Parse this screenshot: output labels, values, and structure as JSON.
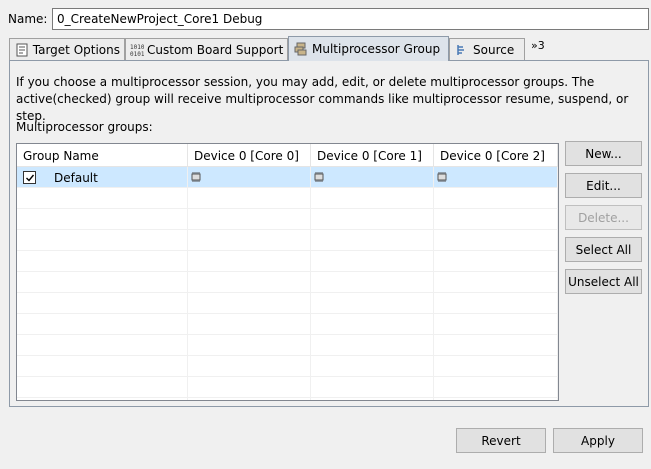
{
  "name": {
    "label": "Name:",
    "value": "0_CreateNewProject_Core1 Debug"
  },
  "tabs": [
    {
      "label": "Target Options",
      "icon": "target-options-icon"
    },
    {
      "label": "Custom Board Support",
      "icon": "board-support-icon"
    },
    {
      "label": "Multiprocessor Group",
      "icon": "multiprocessor-icon",
      "active": true
    },
    {
      "label": "Source",
      "icon": "source-icon"
    }
  ],
  "tabs_overflow": "»3",
  "description": "If you choose a multiprocessor session, you may add, edit, or delete multiprocessor groups.  The active(checked) group will receive multiprocessor commands like multiprocessor resume, suspend, or step.",
  "groups_label": "Multiprocessor groups:",
  "table": {
    "columns": [
      "Group Name",
      "Device 0 [Core 0]",
      "Device 0 [Core 1]",
      "Device 0 [Core 2]"
    ],
    "rows": [
      {
        "checked": true,
        "name": "Default",
        "cores": [
          "chip-icon",
          "chip-icon",
          "chip-icon"
        ]
      }
    ]
  },
  "buttons": {
    "new": "New...",
    "edit": "Edit...",
    "delete": "Delete...",
    "select_all": "Select All",
    "unselect_all": "Unselect All",
    "revert": "Revert",
    "apply": "Apply"
  },
  "colors": {
    "selected_row": "#cde8ff",
    "active_tab": "#dde3ea"
  }
}
